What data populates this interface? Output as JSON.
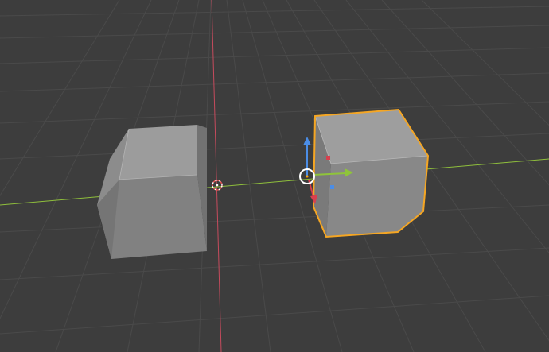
{
  "viewport": {
    "background": "#3d3d3d",
    "grid_color": "#4a4a4a",
    "x_axis_color": "#8fbf3c",
    "y_axis_color": "#c64b5d",
    "z_axis_color": "#4b8de6",
    "selection_outline_color": "#f5a623"
  },
  "objects": [
    {
      "name": "beveled-cube-left",
      "selected": false
    },
    {
      "name": "beveled-cube-right",
      "selected": true
    }
  ],
  "icons": {
    "origin_3d_cursor": "3d-cursor-icon",
    "transform_gizmo": "transform-gizmo-icon"
  }
}
